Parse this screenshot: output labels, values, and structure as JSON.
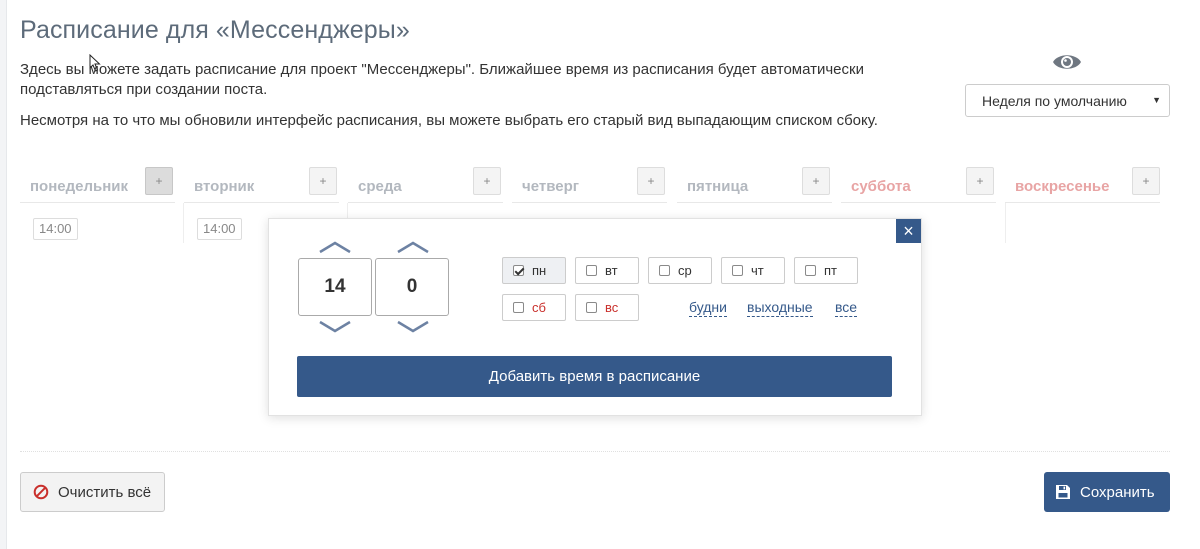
{
  "header": {
    "title": "Расписание для «Мессенджеры»",
    "description": "Здесь вы можете задать расписание для проект \"Мессенджеры\". Ближайшее время из расписания будет автоматически подставляться при создании поста.",
    "note": "Несмотря на то что мы обновили интерфейс расписания, вы можете выбрать его старый вид выпадающим списком сбоку."
  },
  "view": {
    "icon": "eye-icon",
    "select_value": "Неделя по умолчанию"
  },
  "days": [
    {
      "name": "понедельник",
      "weekend": false,
      "times": [
        "14:00"
      ]
    },
    {
      "name": "вторник",
      "weekend": false,
      "times": [
        "14:00"
      ]
    },
    {
      "name": "среда",
      "weekend": false,
      "times": []
    },
    {
      "name": "четверг",
      "weekend": false,
      "times": []
    },
    {
      "name": "пятница",
      "weekend": false,
      "times": []
    },
    {
      "name": "суббота",
      "weekend": true,
      "times": []
    },
    {
      "name": "воскресенье",
      "weekend": true,
      "times": []
    }
  ],
  "plus_label": "+",
  "popup": {
    "close_label": "×",
    "hour": "14",
    "minute": "0",
    "day_checks": [
      {
        "label": "пн",
        "checked": true
      },
      {
        "label": "вт",
        "checked": false
      },
      {
        "label": "ср",
        "checked": false
      },
      {
        "label": "чт",
        "checked": false
      },
      {
        "label": "пт",
        "checked": false
      },
      {
        "label": "сб",
        "checked": false
      },
      {
        "label": "вс",
        "checked": false
      }
    ],
    "quick": {
      "weekdays": "будни",
      "weekends": "выходные",
      "all": "все"
    },
    "add_button": "Добавить время в расписание"
  },
  "footer": {
    "clear_button": "Очистить всё",
    "save_button": "Сохранить"
  },
  "colors": {
    "accent": "#35598a",
    "weekend": "#c9302c",
    "muted_heading": "#b3b8bf"
  }
}
